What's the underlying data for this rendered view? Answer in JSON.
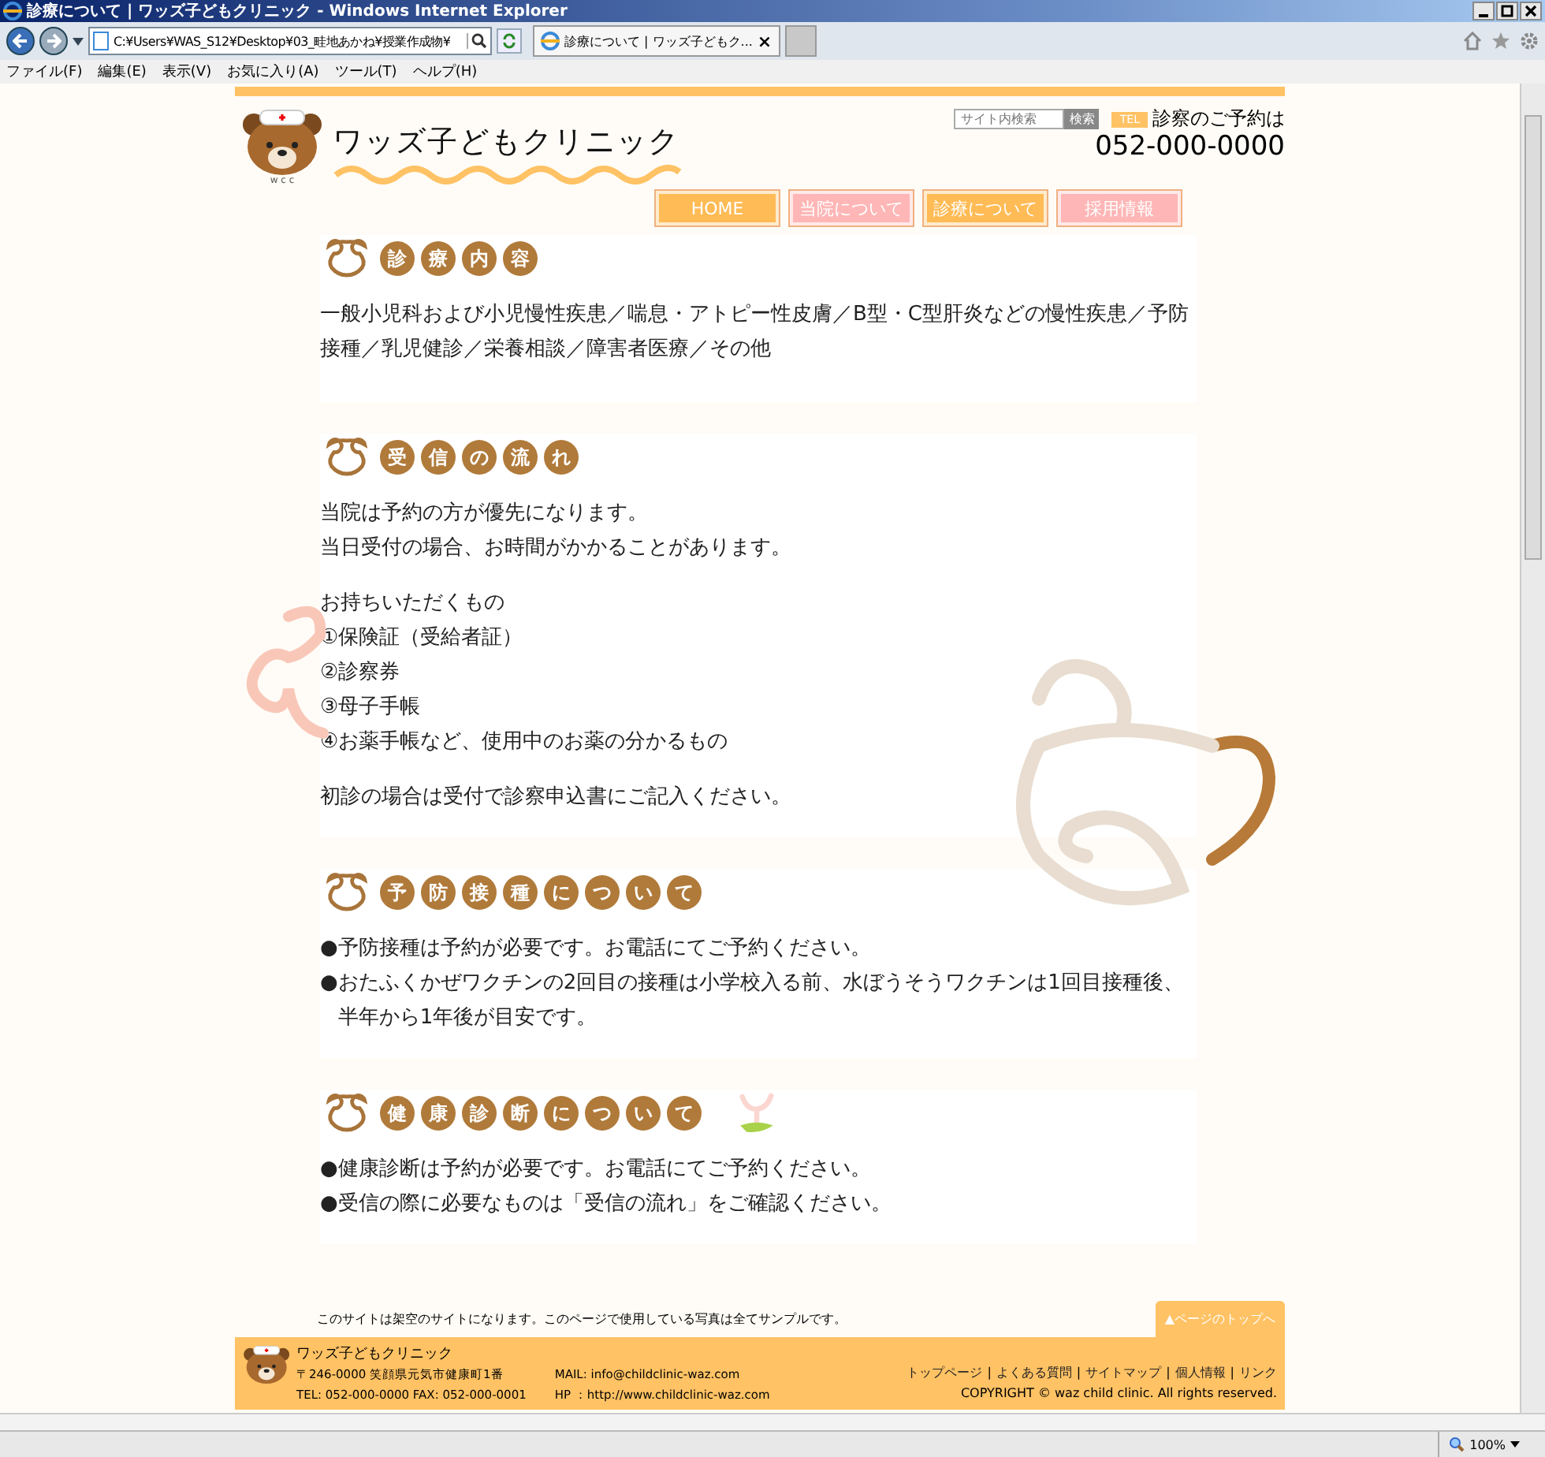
{
  "browser": {
    "title": "診療について | ワッズ子どもクリニック - Windows Internet Explorer",
    "address": "C:¥Users¥WAS_S12¥Desktop¥03_畦地あかね¥授業作成物¥",
    "tab_title": "診療について | ワッズ子どもク...",
    "tab_close": "×",
    "menu": [
      "ファイル(F)",
      "編集(E)",
      "表示(V)",
      "お気に入り(A)",
      "ツール(T)",
      "ヘルプ(H)"
    ],
    "zoom": "100%"
  },
  "header": {
    "site_name": "ワッズ子どもクリニック",
    "logo_caption": "w c c",
    "search_placeholder": "サイト内検索",
    "search_button": "検索",
    "tel_label": "TEL",
    "tel_caption": "診察のご予約は",
    "phone": "052-000-0000"
  },
  "nav": [
    {
      "label": "HOME",
      "color": "#ffbb55"
    },
    {
      "label": "当院について",
      "color": "#ffb6b6"
    },
    {
      "label": "診療について",
      "color": "#ffbb55"
    },
    {
      "label": "採用情報",
      "color": "#ffb6b6"
    }
  ],
  "sections": [
    {
      "title_chars": [
        "診",
        "療",
        "内",
        "容"
      ],
      "blocks": [
        {
          "kind": "para",
          "lines": [
            "一般小児科および小児慢性疾患／喘息・アトピー性皮膚／B型・C型肝炎などの慢性疾患／予防接種／乳児健診／栄養相談／障害者医療／その他"
          ]
        }
      ]
    },
    {
      "title_chars": [
        "受",
        "信",
        "の",
        "流",
        "れ"
      ],
      "blocks": [
        {
          "kind": "para",
          "lines": [
            "当院は予約の方が優先になります。",
            "当日受付の場合、お時間がかかることがあります。"
          ]
        },
        {
          "kind": "para",
          "lines": [
            "お持ちいただくもの",
            "①保険証（受給者証）",
            "②診察券",
            "③母子手帳",
            "④お薬手帳など、使用中のお薬の分かるもの"
          ]
        },
        {
          "kind": "para",
          "lines": [
            "初診の場合は受付で診察申込書にご記入ください。"
          ]
        }
      ]
    },
    {
      "title_chars": [
        "予",
        "防",
        "接",
        "種",
        "に",
        "つ",
        "い",
        "て"
      ],
      "blocks": [
        {
          "kind": "bullets",
          "marker": "●",
          "lines": [
            "予防接種は予約が必要です。お電話にてご予約ください。",
            "おたふくかぜワクチンの2回目の接種は小学校入る前、水ぼうそうワクチンは1回目接種後、半年から1年後が目安です。"
          ]
        }
      ]
    },
    {
      "title_chars": [
        "健",
        "康",
        "診",
        "断",
        "に",
        "つ",
        "い",
        "て"
      ],
      "blocks": [
        {
          "kind": "bullets",
          "marker": "●",
          "lines": [
            "健康診断は予約が必要です。お電話にてご予約ください。",
            "受信の際に必要なものは「受信の流れ」をご確認ください。"
          ]
        }
      ]
    }
  ],
  "footer": {
    "note": "このサイトは架空のサイトになります。このページで使用している写真は全てサンプルです。",
    "page_top": "▲ページのトップへ",
    "name": "ワッズ子どもクリニック",
    "address": "〒246-0000 笑顔県元気市健康町1番",
    "tel_fax": "TEL: 052-000-0000 FAX: 052-000-0001",
    "mail": "MAIL: info@childclinic-waz.com",
    "hp": "HP ：http://www.childclinic-waz.com",
    "links": [
      "トップページ",
      "よくある質問",
      "サイトマップ",
      "個人情報",
      "リンク"
    ],
    "separator": "|",
    "copyright": "COPYRIGHT © waz child clinic. All rights reserved."
  }
}
